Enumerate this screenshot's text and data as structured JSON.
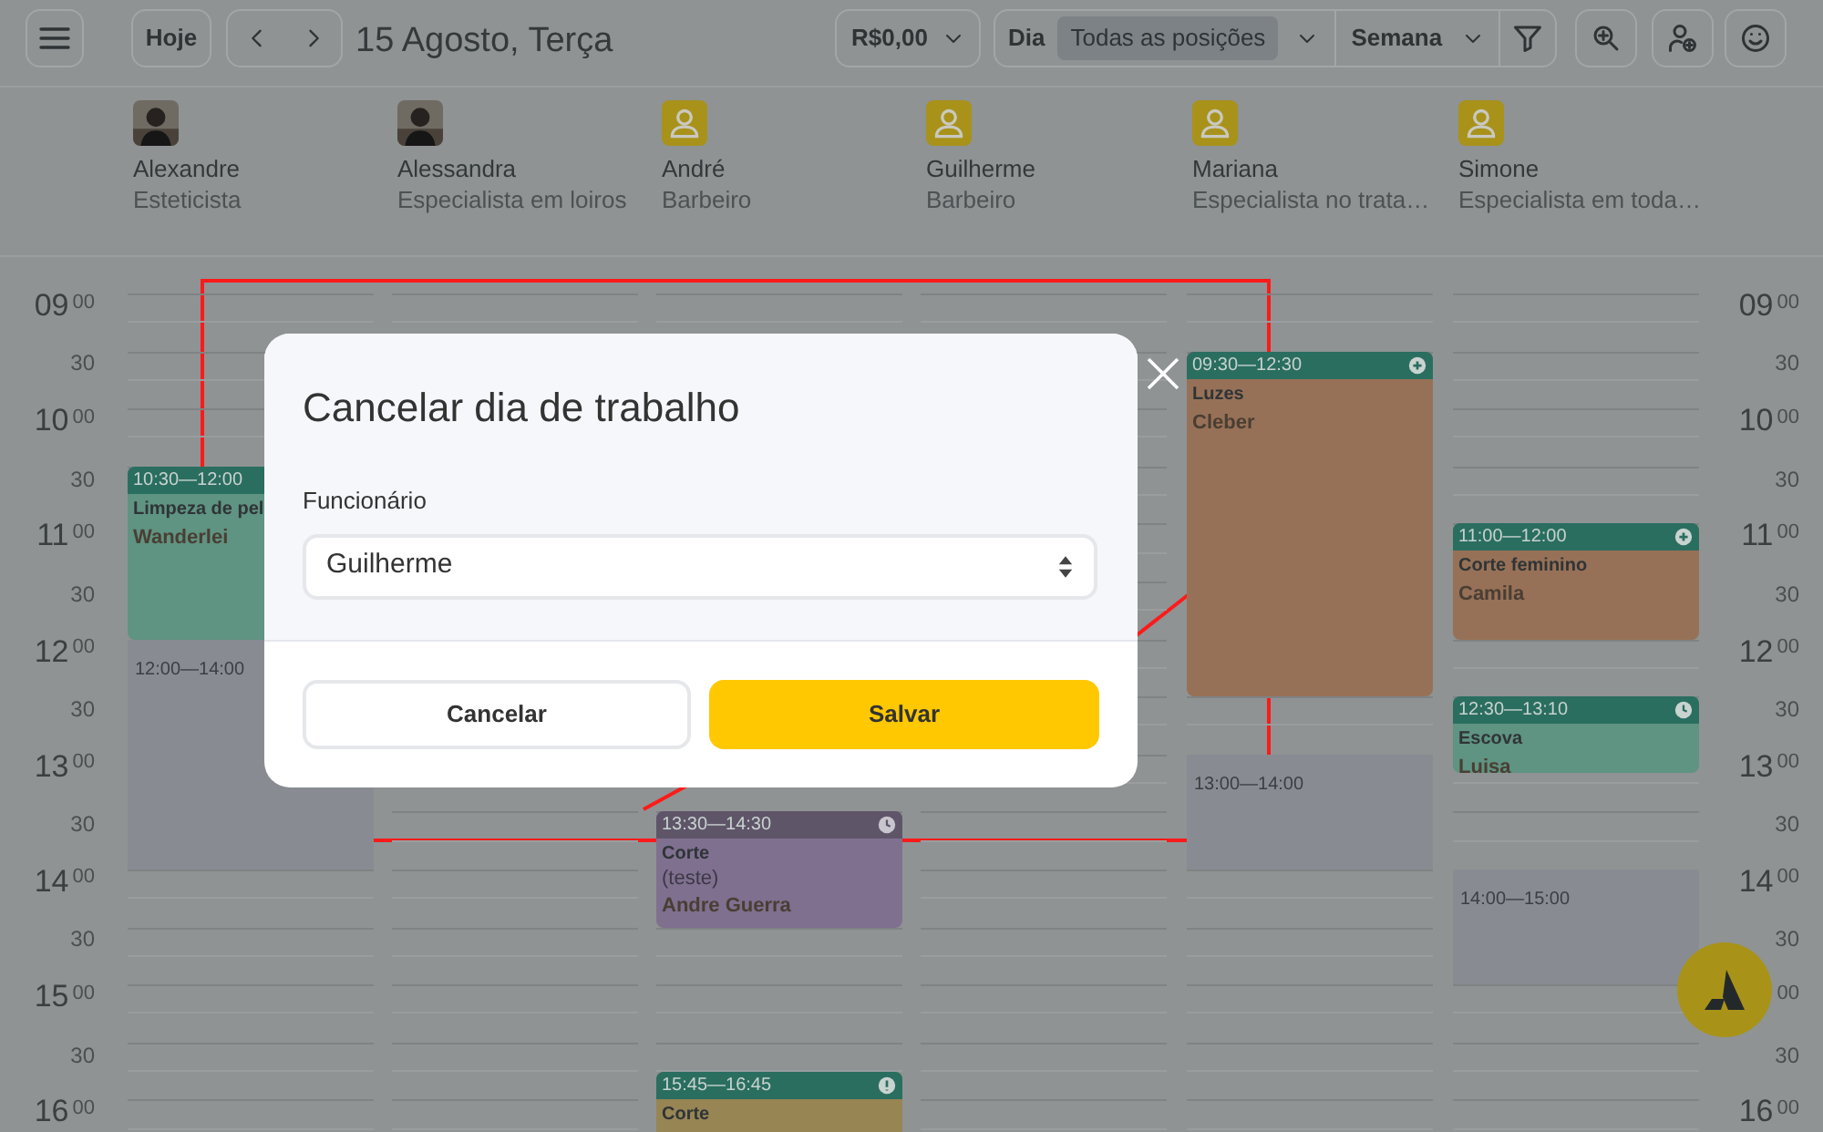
{
  "toolbar": {
    "today": "Hoje",
    "date": "15 Agosto, Terça",
    "revenue": "R$0,00",
    "day": "Dia",
    "positions": {
      "label": "Todas as posições",
      "selected": true
    },
    "period": "Semana"
  },
  "staff": [
    {
      "name": "Alexandre",
      "role": "Esteticista",
      "events": [
        {
          "kind": "plain",
          "time": "10:30—12:00",
          "service": "Limpeza de pel",
          "client": "Wanderlei",
          "color": "#5f9382"
        },
        {
          "kind": "blocked",
          "time": "12:00—14:00"
        }
      ]
    },
    {
      "name": "Alessandra",
      "role": "Especialista em loiros"
    },
    {
      "name": "André",
      "role": "Barbeiro",
      "kind": "placeholder",
      "events": [
        {
          "kind": "reserved",
          "time": "13:30—14:30",
          "service": "Corte",
          "notes": "(teste)",
          "client": "Andre Guerra",
          "color": "#7f7090"
        },
        {
          "kind": "alert",
          "time": "15:45—16:45",
          "service": "Corte",
          "color": "#978554"
        }
      ]
    },
    {
      "name": "Guilherme",
      "role": "Barbeiro",
      "kind": "placeholder"
    },
    {
      "name": "Mariana",
      "role": "Especialista no trata…",
      "kind": "placeholder",
      "events": [
        {
          "kind": "new",
          "time": "09:30—12:30",
          "service": "Luzes",
          "client": "Cleber",
          "color": "#977157"
        },
        {
          "kind": "blocked",
          "time": "13:00—14:00"
        }
      ]
    },
    {
      "name": "Simone",
      "role": "Especialista em toda…",
      "kind": "placeholder",
      "events": [
        {
          "kind": "new",
          "time": "11:00—12:00",
          "service": "Corte feminino",
          "client": "Camila",
          "color": "#977157"
        },
        {
          "kind": "waiting",
          "time": "12:30—13:10",
          "service": "Escova",
          "client": "Luisa",
          "color": "#5f9382"
        },
        {
          "kind": "blocked",
          "time": "14:00—15:00"
        }
      ]
    }
  ],
  "times_left": [
    {
      "kind": "hour",
      "hour": "09",
      "minutes": "00"
    },
    {
      "kind": "half",
      "minutes": "30"
    },
    {
      "kind": "hour",
      "hour": "10",
      "minutes": "00"
    },
    {
      "kind": "half",
      "minutes": "30"
    },
    {
      "kind": "hour",
      "hour": "11",
      "minutes": "00"
    },
    {
      "kind": "half",
      "minutes": "30"
    },
    {
      "kind": "hour",
      "hour": "12",
      "minutes": "00"
    },
    {
      "kind": "half",
      "minutes": "30"
    },
    {
      "kind": "hour",
      "hour": "13",
      "minutes": "00"
    },
    {
      "kind": "half",
      "minutes": "30"
    },
    {
      "kind": "hour",
      "hour": "14",
      "minutes": "00"
    },
    {
      "kind": "half",
      "minutes": "30"
    },
    {
      "kind": "hour",
      "hour": "15",
      "minutes": "00"
    },
    {
      "kind": "half",
      "minutes": "30"
    },
    {
      "kind": "hour",
      "hour": "16",
      "minutes": "00"
    }
  ],
  "times_right": [
    {
      "kind": "hour",
      "hour": "09",
      "minutes": "00"
    },
    {
      "kind": "half",
      "minutes": "30"
    },
    {
      "kind": "hour",
      "hour": "10",
      "minutes": "00"
    },
    {
      "kind": "half",
      "minutes": "30"
    },
    {
      "kind": "hour",
      "hour": "11",
      "minutes": "00"
    },
    {
      "kind": "half",
      "minutes": "30"
    },
    {
      "kind": "hour",
      "hour": "12",
      "minutes": "00"
    },
    {
      "kind": "half",
      "minutes": "30"
    },
    {
      "kind": "hour",
      "hour": "13",
      "minutes": "00"
    },
    {
      "kind": "half",
      "minutes": "30"
    },
    {
      "kind": "hour",
      "hour": "14",
      "minutes": "00"
    },
    {
      "kind": "half",
      "minutes": "30"
    },
    {
      "kind": "hour",
      "minutes": "00"
    },
    {
      "kind": "half",
      "minutes": "30"
    },
    {
      "kind": "hour",
      "hour": "16",
      "minutes": "00"
    }
  ],
  "dialog": {
    "title": "Cancelar dia de trabalho",
    "field_label": "Funcionário",
    "employee": "Guilherme",
    "cancel": "Cancelar",
    "save": "Salvar"
  }
}
